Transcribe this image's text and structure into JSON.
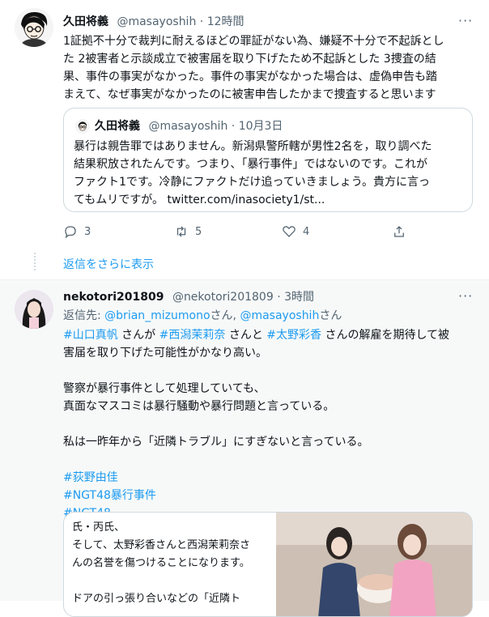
{
  "tweet1": {
    "name": "久田将義",
    "handle": "@masayoshih",
    "dot": "·",
    "time": "12時間",
    "more": "···",
    "lines": [
      "1証拠不十分で裁判に耐えるほどの罪証がない為、嫌疑不十分で不起訴とし",
      "た 2被害者と示談成立で被害届を取り下げたため不起訴とした 3捜査の結",
      "果、事件の事実がなかった。事件の事実がなかった場合は、虚偽申告も踏",
      "まえて、なぜ事実がなかったのに被害申告したかまで捜査すると思います"
    ],
    "quote": {
      "name": "久田将義",
      "handle": "@masayoshih",
      "dot": "·",
      "date": "10月3日",
      "lines": [
        "暴行は親告罪ではありません。新潟県警所轄が男性2名を，取り調べた",
        "結果釈放されたんです。つまり、「暴行事件」ではないのです。これが",
        "ファクト1です。冷静にファクトだけ追っていきましょう。貴方に言っ",
        "てもムリですが。 twitter.com/inasociety1/st..."
      ]
    },
    "actions": {
      "reply_count": "3",
      "retweet_count": "5",
      "like_count": "4"
    },
    "show_more": "返信をさらに表示"
  },
  "tweet2": {
    "name": "nekotori201809",
    "handle": "@nekotori201809",
    "dot": "·",
    "time": "3時間",
    "more": "···",
    "reply_prefix": "返信先: ",
    "reply_to_1": "@brian_mizumono",
    "reply_san_1": "さん, ",
    "reply_to_2": "@masayoshih",
    "reply_san_2": "さん",
    "line1_tag1": "#山口真帆",
    "line1_t1": " さんが ",
    "line1_tag2": "#西潟茉莉奈",
    "line1_t2": " さんと ",
    "line1_tag3": "#太野彩香",
    "line1_t3": " さんの解雇を期待して被",
    "line2": "害届を取り下げた可能性がかなり高い。",
    "line3": "警察が暴行事件として処理していても、",
    "line4": "真面なマスコミは暴行騒動や暴行問題と言っている。",
    "line5": "私は一昨年から「近隣トラブル」にすぎないと言っている。",
    "hashtags": [
      "#荻野由佳",
      "#NGT48暴行事件",
      "#NGT48"
    ],
    "media_lines": [
      "氏・丙氏、",
      "そして、太野彩香さんと西潟茉莉奈さ",
      "んの名誉を傷つけることになります。",
      "",
      "ドアの引っ張り合いなどの「近隣ト"
    ]
  },
  "colors": {
    "link": "#1d9bf0",
    "secondary_text": "#536471",
    "border": "#cfd9de"
  },
  "icons": [
    "avatar-hisada",
    "avatar-nekotori",
    "reply-icon",
    "retweet-icon",
    "like-icon",
    "share-icon",
    "more-icon"
  ]
}
